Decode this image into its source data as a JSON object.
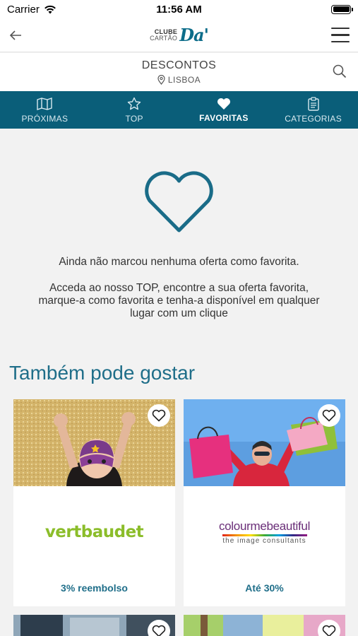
{
  "status": {
    "carrier": "Carrier",
    "time": "11:56 AM"
  },
  "header": {
    "logo_line1": "CLUBE",
    "logo_line2": "CARTÃO",
    "logo_mark": "Da'"
  },
  "titlebar": {
    "title": "DESCONTOS",
    "location": "LISBOA"
  },
  "tabs": [
    {
      "label": "PRÓXIMAS",
      "icon": "map-icon"
    },
    {
      "label": "TOP",
      "icon": "star-icon"
    },
    {
      "label": "FAVORITAS",
      "icon": "heart-icon",
      "active": true
    },
    {
      "label": "CATEGORIAS",
      "icon": "clipboard-icon"
    }
  ],
  "empty_state": {
    "message1": "Ainda não marcou nenhuma oferta como favorita.",
    "message2": "Acceda ao nosso TOP, encontre a sua oferta favorita, marque-a como favorita e tenha-a disponível em qualquer lugar com um clique"
  },
  "suggestions": {
    "title": "Também pode gostar",
    "cards": [
      {
        "brand": "vertbaudet",
        "offer": "3% reembolso"
      },
      {
        "brand_name": "colourmebeautiful",
        "brand_sub": "the image consultants",
        "offer": "Até 30%"
      }
    ]
  },
  "colors": {
    "primary": "#0a5e79",
    "accent_text": "#1f6e89"
  }
}
